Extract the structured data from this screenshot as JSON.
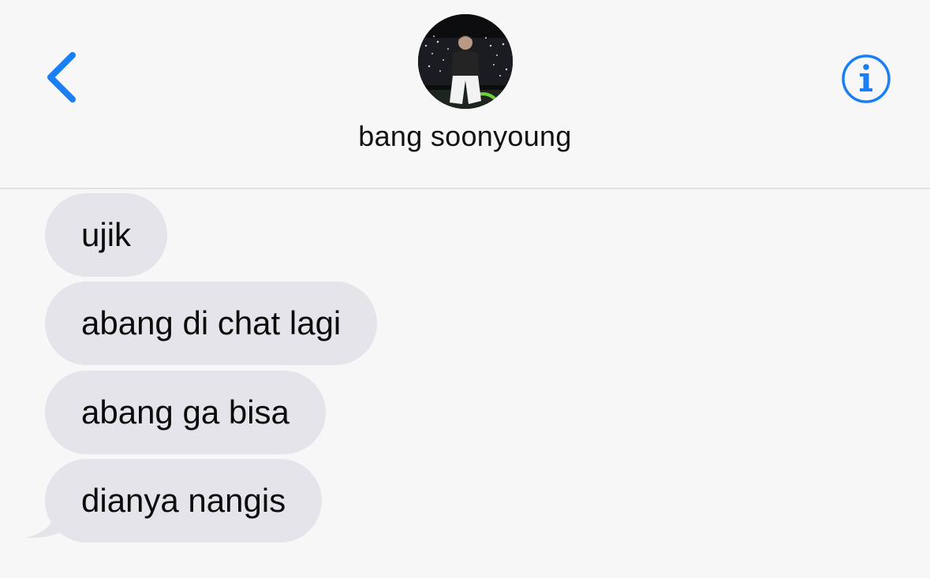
{
  "header": {
    "contact_name": "bang soonyoung",
    "back_icon": "chevron-left-icon",
    "info_icon": "info-circle-icon",
    "accent_color": "#1a7ef5"
  },
  "messages": [
    {
      "text": "ujik",
      "sender": "contact"
    },
    {
      "text": "abang di chat lagi",
      "sender": "contact"
    },
    {
      "text": "abang ga bisa",
      "sender": "contact"
    },
    {
      "text": "dianya nangis",
      "sender": "contact"
    }
  ],
  "colors": {
    "background": "#f7f7f8",
    "incoming_bubble": "#e5e4ea",
    "divider": "#e1e0e6"
  }
}
